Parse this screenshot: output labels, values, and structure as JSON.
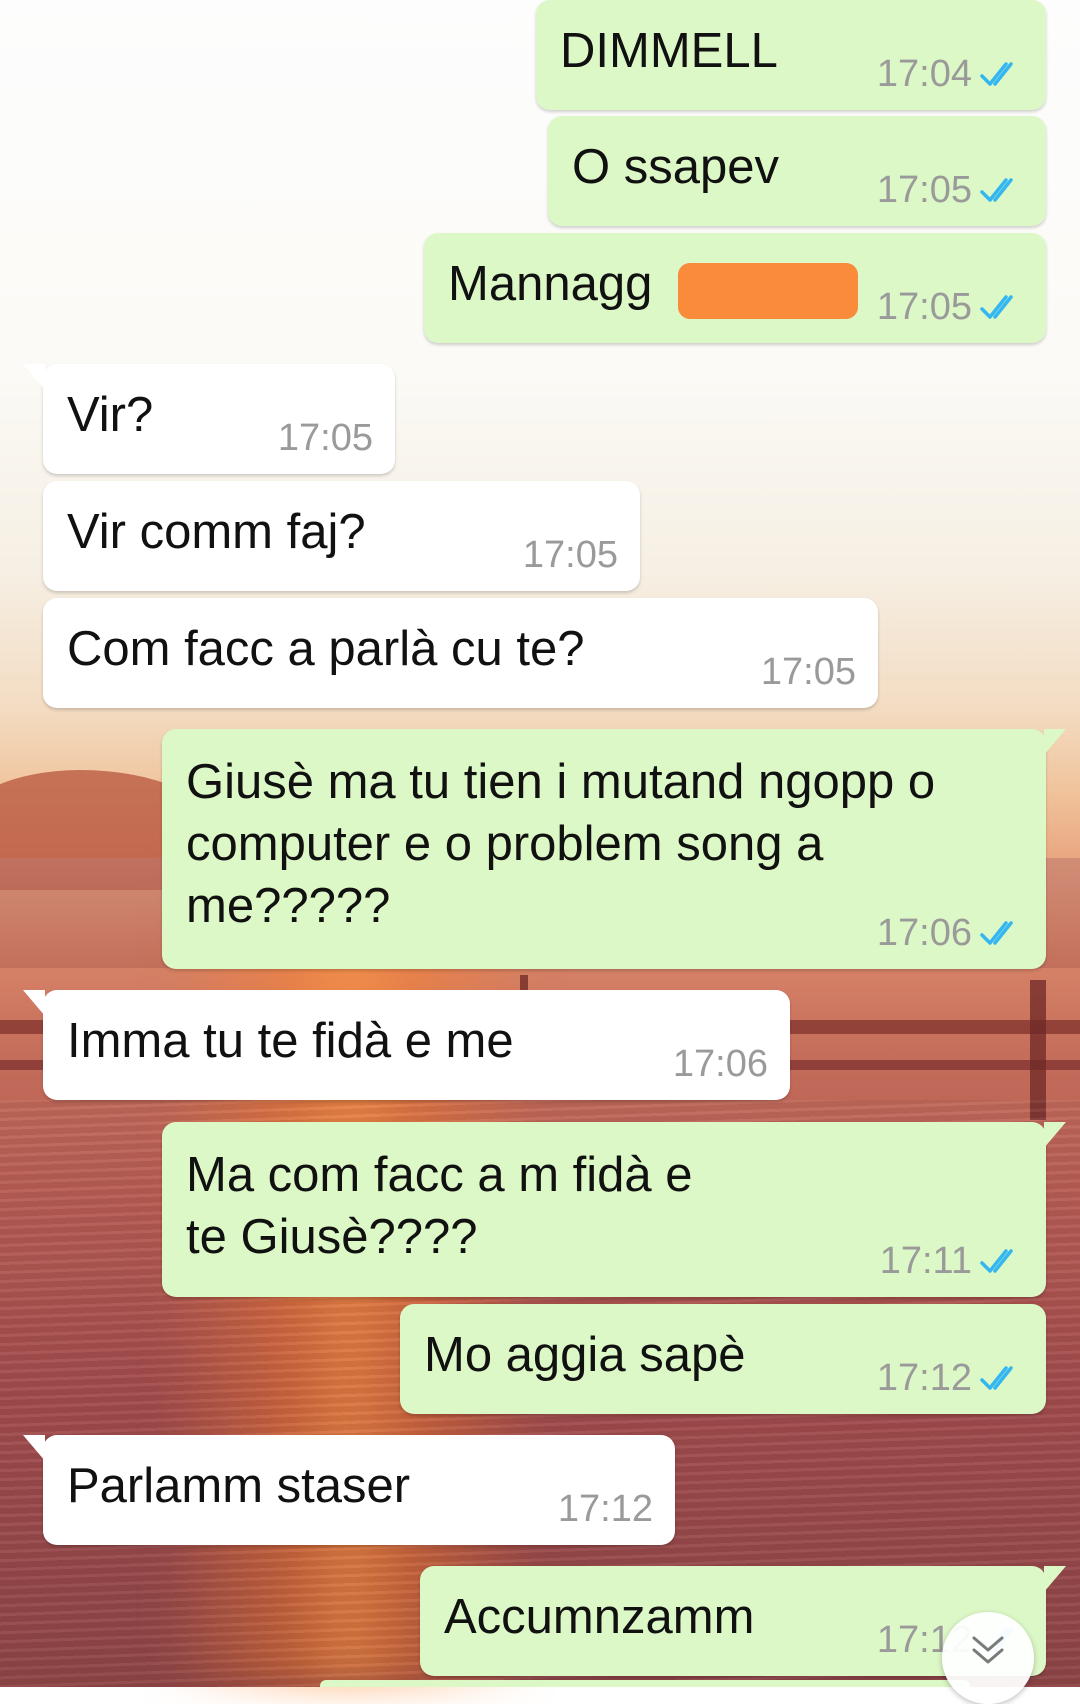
{
  "conversation": {
    "messages": [
      {
        "direction": "outgoing",
        "text": "DIMMELL",
        "time": "17:04",
        "status": "read"
      },
      {
        "direction": "outgoing",
        "text": "O ssapev",
        "time": "17:05",
        "status": "read"
      },
      {
        "direction": "outgoing",
        "text": "Mannagg",
        "time": "17:05",
        "status": "read",
        "redacted_tail": true
      },
      {
        "direction": "incoming",
        "text": "Vir?",
        "time": "17:05"
      },
      {
        "direction": "incoming",
        "text": "Vir comm faj?",
        "time": "17:05"
      },
      {
        "direction": "incoming",
        "text": "Com facc a parlà cu te?",
        "time": "17:05"
      },
      {
        "direction": "outgoing",
        "text": "Giusè ma tu tien i mutand ngopp o computer e o problem song a me?????",
        "time": "17:06",
        "status": "read"
      },
      {
        "direction": "incoming",
        "text": "Imma tu te fidà e me",
        "time": "17:06"
      },
      {
        "direction": "outgoing",
        "text": "Ma com facc a m fidà e te Giusè????",
        "time": "17:11",
        "status": "read"
      },
      {
        "direction": "outgoing",
        "text": "Mo aggia sapè",
        "time": "17:12",
        "status": "read"
      },
      {
        "direction": "incoming",
        "text": "Parlamm staser",
        "time": "17:12"
      },
      {
        "direction": "outgoing",
        "text": "Accumnzamm",
        "time": "17:12",
        "status": "read"
      }
    ]
  },
  "icons": {
    "read_receipt": "double-check-icon",
    "scroll_down": "double-chevron-down-icon"
  },
  "colors": {
    "outgoing_bubble": "#dcf8c6",
    "incoming_bubble": "#ffffff",
    "read_tick": "#34b7f1",
    "timestamp": "#9a9a9a",
    "redaction": "#f98b3b"
  }
}
